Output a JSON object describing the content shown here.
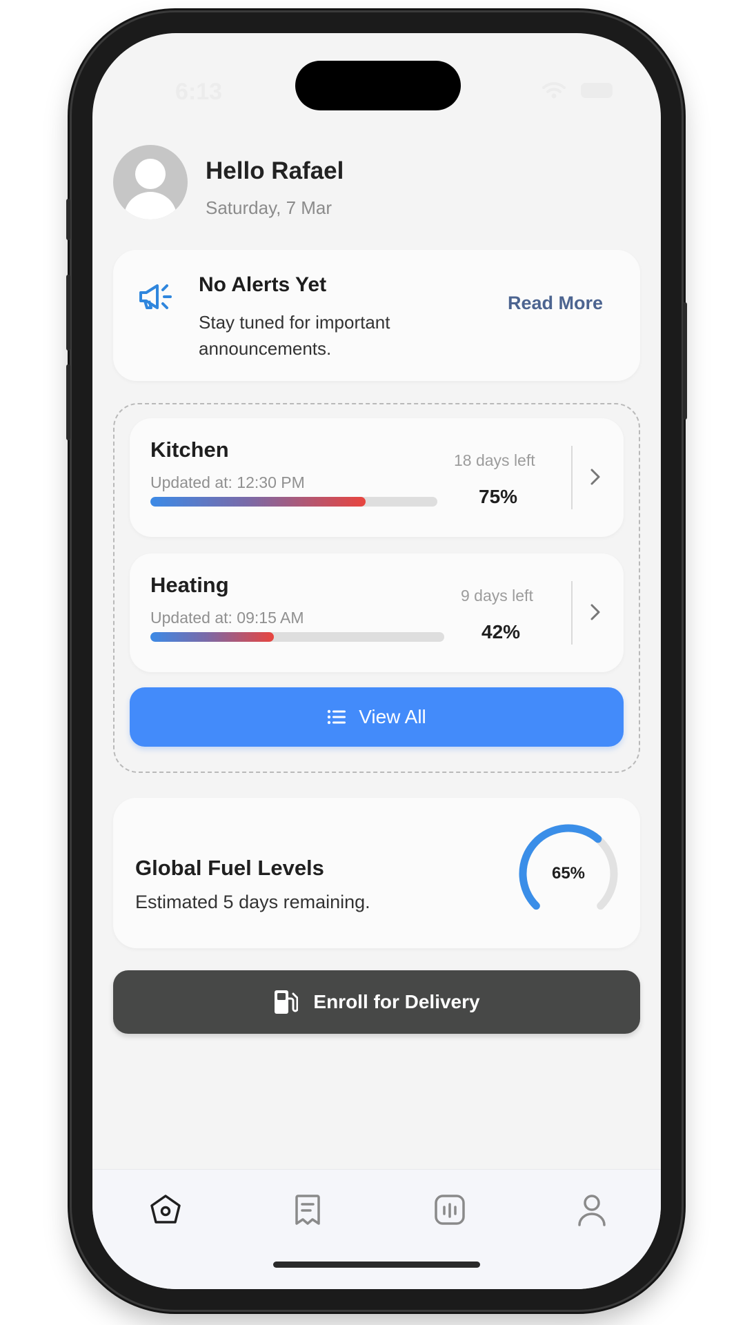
{
  "status_bar": {
    "time": "6:13"
  },
  "header": {
    "greeting": "Hello Rafael",
    "date": "Saturday, 7 Mar",
    "avatar_icon": "user-avatar-icon"
  },
  "alert": {
    "icon": "megaphone-icon",
    "title": "No Alerts Yet",
    "text": "Stay tuned for important announcements.",
    "action": "Read More"
  },
  "tanks": [
    {
      "name": "Kitchen",
      "updated": "Updated at: 12:30 PM",
      "days_left": "18 days left",
      "percent_label": "75%",
      "level": 0.75
    },
    {
      "name": "Heating",
      "updated": "Updated at: 09:15 AM",
      "days_left": "9 days left",
      "percent_label": "42%",
      "level": 0.42
    }
  ],
  "view_all": {
    "label": "View All",
    "icon": "list-icon"
  },
  "fuel": {
    "title": "Global Fuel Levels",
    "subtitle": "Estimated 5 days remaining.",
    "percent_label": "65%",
    "level": 0.65
  },
  "enroll": {
    "label": "Enroll for Delivery",
    "icon": "fuel-pump-icon"
  },
  "tabs": [
    {
      "id": "home",
      "icon": "home-icon",
      "active": true
    },
    {
      "id": "receipts",
      "icon": "receipt-icon",
      "active": false
    },
    {
      "id": "gauges",
      "icon": "gauge-icon",
      "active": false
    },
    {
      "id": "profile",
      "icon": "profile-icon",
      "active": false
    }
  ],
  "colors": {
    "accent_blue": "#438bfa",
    "link": "#4c6490",
    "gauge_blue": "#3a8ee8",
    "dark_button": "#474847",
    "bar_start": "#3c8ae6",
    "bar_end": "#e8453f"
  }
}
